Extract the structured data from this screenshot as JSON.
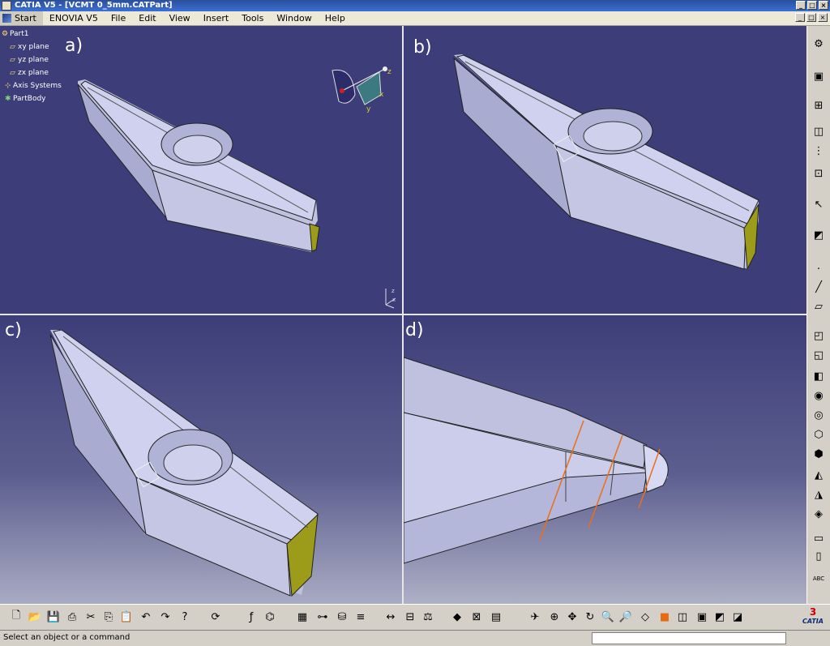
{
  "window": {
    "title": "CATIA V5 - [VCMT 0_5mm.CATPart]"
  },
  "menu": {
    "items": [
      "Start",
      "ENOVIA V5",
      "File",
      "Edit",
      "View",
      "Insert",
      "Tools",
      "Window",
      "Help"
    ]
  },
  "tree": {
    "nodes": [
      "Part1",
      "xy plane",
      "yz plane",
      "zx plane",
      "Axis Systems",
      "PartBody"
    ]
  },
  "panes": {
    "a": "a)",
    "b": "b)",
    "c": "c)",
    "d": "d)"
  },
  "compass": {
    "x": "x",
    "y": "y",
    "z": "z"
  },
  "status": {
    "text": "Select an object or a command"
  },
  "logo": {
    "text": "CATIA"
  },
  "colors": {
    "viewport": "#3d3d79",
    "insert_face": "#c9cbe9",
    "chamfer": "#b0a81a",
    "markers": "#e87018"
  }
}
